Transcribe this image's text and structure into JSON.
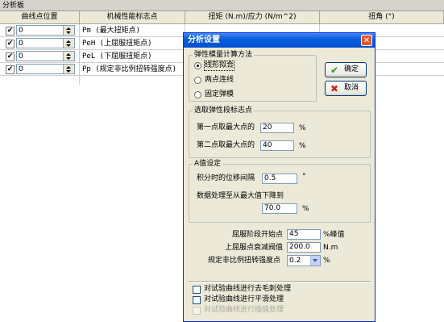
{
  "panel": {
    "title": "分析板",
    "columns": [
      "曲线点位置",
      "机械性能标志点",
      "扭矩 (N.m)/应力 (N/m^2)",
      "扭角 (°)"
    ],
    "rows": [
      {
        "checked": "✔",
        "value": "0",
        "mark": "Pm (最大扭矩点)"
      },
      {
        "checked": "✔",
        "value": "0",
        "mark": "PeH (上屈服扭矩点)"
      },
      {
        "checked": "✔",
        "value": "0",
        "mark": "PeL (下屈服扭矩点)"
      },
      {
        "checked": "✔",
        "value": "0",
        "mark": "Pp (规定非比例扭转强度点)"
      }
    ]
  },
  "dialog": {
    "title": "分析设置",
    "close_label": "✕",
    "ok_label": "确定",
    "cancel_label": "取消",
    "modulus_group": {
      "label": "弹性模量计算方法",
      "options": [
        "线形拟合",
        "两点连线",
        "固定弹模"
      ],
      "selected": "线形拟合"
    },
    "elastic_group": {
      "label": "选取弹性段标志点",
      "first_label": "第一点取最大点的",
      "first_value": "20",
      "second_label": "第二点取最大点的",
      "second_value": "40",
      "unit": "%"
    },
    "a_group": {
      "label": "A值设定",
      "interval_label": "积分时的位移间隔",
      "interval_value": "0.5",
      "interval_unit": "°",
      "drop_label": "数据处理至从最大值下降到",
      "drop_value": "70.0",
      "drop_unit": "%"
    },
    "yield_start_label": "屈服阶段开始点",
    "yield_start_value": "45",
    "yield_start_unit": "%峰值",
    "upper_yield_label": "上屈服点衰减阀值",
    "upper_yield_value": "200.0",
    "upper_yield_unit": "N.m",
    "nonprop_label": "规定非比例扭转强度点",
    "nonprop_value": "0.2",
    "nonprop_unit": "%",
    "checks": [
      {
        "label": "对试验曲线进行去毛刺处理",
        "enabled": true
      },
      {
        "label": "对试验曲线进行平滑处理",
        "enabled": true
      },
      {
        "label": "对试验曲线进行插值处理",
        "enabled": false
      }
    ]
  }
}
